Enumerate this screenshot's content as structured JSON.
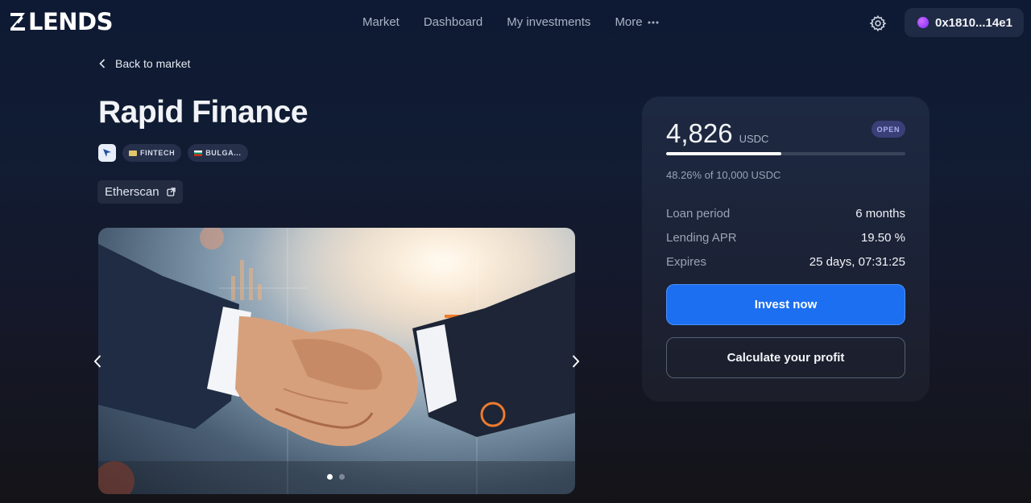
{
  "header": {
    "logo_text": "LENDS",
    "nav": [
      "Market",
      "Dashboard",
      "My investments"
    ],
    "more_label": "More",
    "wallet_address": "0x1810...14e1"
  },
  "page": {
    "back_label": "Back to market",
    "title": "Rapid Finance",
    "tags": [
      "FINTECH",
      "BULGA..."
    ],
    "etherscan_label": "Etherscan"
  },
  "carousel": {
    "slide_count": 2,
    "active_slide": 1
  },
  "invest_card": {
    "amount": "4,826",
    "unit": "USDC",
    "status": "OPEN",
    "progress_fraction": 0.4826,
    "progress_text": "48.26% of 10,000 USDC",
    "rows": [
      {
        "label": "Loan period",
        "value": "6 months"
      },
      {
        "label": "Lending APR",
        "value": "19.50 %"
      },
      {
        "label": "Expires",
        "value": "25 days, 07:31:25"
      }
    ],
    "primary_button": "Invest now",
    "secondary_button": "Calculate your profit"
  },
  "colors": {
    "accent": "#1c6ff0",
    "badge_bg": "#3a3f77"
  }
}
